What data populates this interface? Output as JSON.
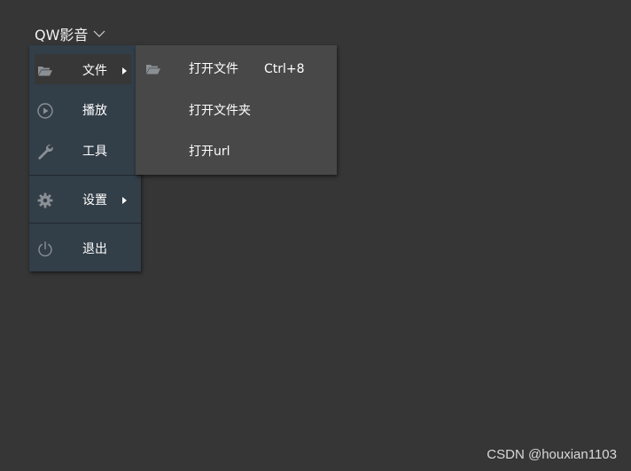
{
  "app": {
    "title": "QW影音",
    "dropdown_icon": "chevron-down-icon"
  },
  "menu": {
    "items": [
      {
        "label": "文件",
        "icon": "folder-open-icon",
        "has_submenu": true,
        "highlighted": true
      },
      {
        "label": "播放",
        "icon": "play-circle-icon",
        "has_submenu": false
      },
      {
        "label": "工具",
        "icon": "wrench-icon",
        "has_submenu": false
      },
      {
        "label": "设置",
        "icon": "gear-icon",
        "has_submenu": true
      },
      {
        "label": "退出",
        "icon": "power-icon",
        "has_submenu": false
      }
    ]
  },
  "submenu": {
    "items": [
      {
        "label": "打开文件",
        "shortcut": "Ctrl+8",
        "icon": "folder-open-icon"
      },
      {
        "label": "打开文件夹"
      },
      {
        "label": "打开url"
      }
    ]
  },
  "watermark": "CSDN @houxian1103",
  "colors": {
    "background": "#363636",
    "menu_bg": "#323e48",
    "submenu_bg": "#484848",
    "highlight_bg": "#373737",
    "icon": "#8a8f94"
  }
}
